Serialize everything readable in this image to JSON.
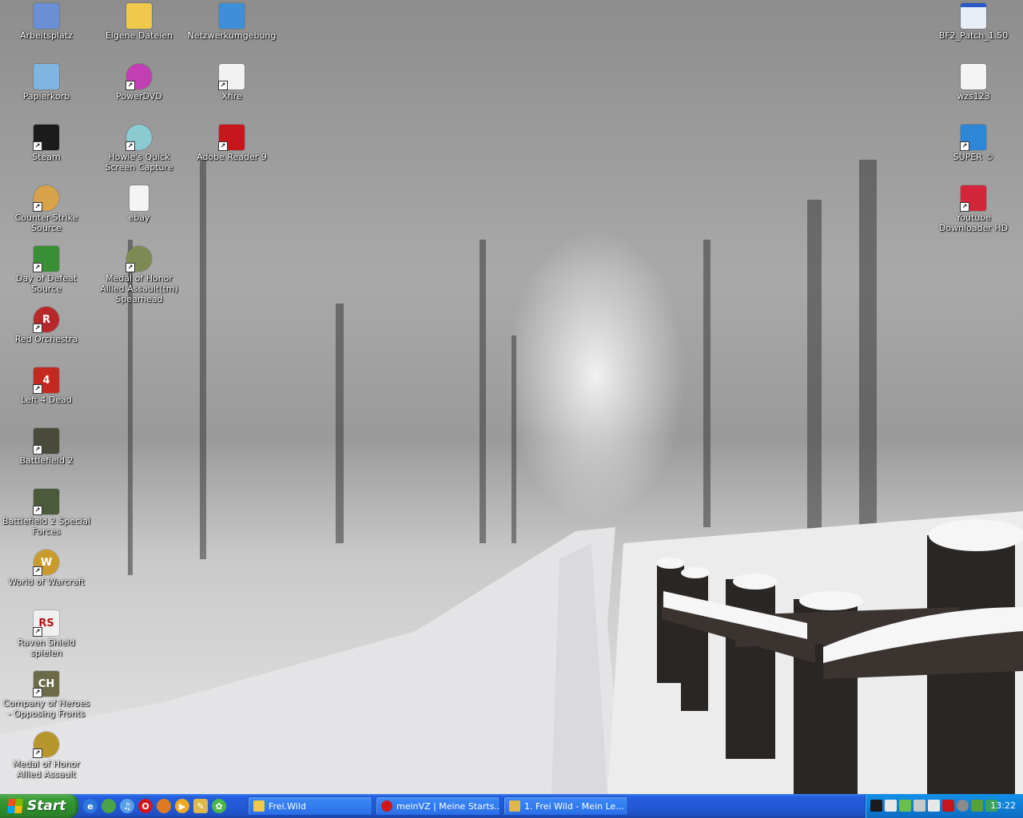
{
  "desktop": {
    "icons": [
      {
        "label": "Arbeitsplatz",
        "icon": "my-computer-icon",
        "color": "#6a8fd6",
        "glyph": "",
        "shortcut": false
      },
      {
        "label": "Eigene Dateien",
        "icon": "my-documents-folder-icon",
        "color": "#f0c94a",
        "glyph": "",
        "shortcut": false
      },
      {
        "label": "Netzwerkumgebung",
        "icon": "network-places-icon",
        "color": "#3f8fd8",
        "glyph": "",
        "shortcut": false
      },
      {
        "label": "Papierkorb",
        "icon": "recycle-bin-icon",
        "color": "#7fb5e0",
        "glyph": "",
        "shortcut": false
      },
      {
        "label": "PowerDVD",
        "icon": "powerdvd-disc-icon",
        "color": "#c13fb3",
        "glyph": "",
        "shortcut": true
      },
      {
        "label": "Xfire",
        "icon": "xfire-icon",
        "color": "#f2f2f2",
        "glyph": "",
        "shortcut": true
      },
      {
        "label": "Steam",
        "icon": "steam-icon",
        "color": "#1b1b1b",
        "glyph": "",
        "shortcut": true
      },
      {
        "label": "Howie's Quick Screen Capture",
        "icon": "camera-capture-icon",
        "color": "#8bcad1",
        "glyph": "",
        "shortcut": true
      },
      {
        "label": "Adobe Reader 9",
        "icon": "adobe-reader-icon",
        "color": "#c8161d",
        "glyph": "",
        "shortcut": true
      },
      {
        "label": "Counter-Strike Source",
        "icon": "counter-strike-icon",
        "color": "#d8a24a",
        "glyph": "",
        "shortcut": true
      },
      {
        "label": "ebay",
        "icon": "text-document-icon",
        "color": "#f4f4f4",
        "glyph": "",
        "shortcut": false
      },
      {
        "label": "Day of Defeat Source",
        "icon": "day-of-defeat-icon",
        "color": "#3a8f36",
        "glyph": "",
        "shortcut": true
      },
      {
        "label": "Medal of Honor Allied Assault(tm) Spearhead",
        "icon": "medal-of-honor-spearhead-icon",
        "color": "#7d8a54",
        "glyph": "",
        "shortcut": true
      },
      {
        "label": "Red Orchestra",
        "icon": "red-orchestra-icon",
        "color": "#b8282a",
        "glyph": "R",
        "shortcut": true
      },
      {
        "label": "Left 4 Dead",
        "icon": "left-4-dead-icon",
        "color": "#c42820",
        "glyph": "4",
        "shortcut": true
      },
      {
        "label": "Battlefield 2",
        "icon": "battlefield-2-icon",
        "color": "#4a4a3a",
        "glyph": "",
        "shortcut": true
      },
      {
        "label": "Battlefield 2 Special Forces",
        "icon": "battlefield-2-sf-icon",
        "color": "#4a5a3a",
        "glyph": "",
        "shortcut": true
      },
      {
        "label": "World of Warcraft",
        "icon": "world-of-warcraft-icon",
        "color": "#c99a2e",
        "glyph": "W",
        "shortcut": true
      },
      {
        "label": "Raven Shield spielen",
        "icon": "raven-shield-icon",
        "color": "#f0f0f0",
        "glyph": "RS",
        "shortcut": true
      },
      {
        "label": "Company of Heroes - Opposing Fronts",
        "icon": "company-of-heroes-icon",
        "color": "#6b6b4a",
        "glyph": "CH",
        "shortcut": true
      },
      {
        "label": "Medal of Honor Allied Assault",
        "icon": "medal-of-honor-icon",
        "color": "#b8962e",
        "glyph": "",
        "shortcut": true
      },
      {
        "label": "BF2_Patch_1.50",
        "icon": "application-window-icon",
        "color": "#e8eef8",
        "glyph": "",
        "shortcut": false
      },
      {
        "label": "wzs123",
        "icon": "wzs-file-icon",
        "color": "#f4f4f4",
        "glyph": "",
        "shortcut": false
      },
      {
        "label": "SUPER ©",
        "icon": "super-media-icon",
        "color": "#2f86d6",
        "glyph": "",
        "shortcut": true
      },
      {
        "label": "Youtube Downloader HD",
        "icon": "youtube-downloader-icon",
        "color": "#d4263a",
        "glyph": "",
        "shortcut": true
      }
    ]
  },
  "taskbar": {
    "start_label": "Start",
    "quick_launch": [
      {
        "icon": "internet-explorer-icon",
        "color": "#2d78d8"
      },
      {
        "icon": "messenger-icon",
        "color": "#4aa548"
      },
      {
        "icon": "itunes-icon",
        "color": "#5aa0e8"
      },
      {
        "icon": "opera-icon",
        "color": "#d0161b"
      },
      {
        "icon": "firefox-icon",
        "color": "#e07a1e"
      },
      {
        "icon": "media-player-icon",
        "color": "#f0a81e"
      },
      {
        "icon": "pencil-icon",
        "color": "#e0b84a"
      },
      {
        "icon": "icq-flower-icon",
        "color": "#4ab84a"
      }
    ],
    "tasks": [
      {
        "label": "Frei.Wild",
        "icon": "folder-icon",
        "color": "#f0c94a"
      },
      {
        "label": "meinVZ | Meine Starts...",
        "icon": "opera-icon",
        "color": "#d0161b"
      },
      {
        "label": "1. Frei Wild - Mein Le...",
        "icon": "pencil-icon",
        "color": "#e0b84a"
      }
    ],
    "tray_icons": [
      {
        "icon": "steam-tray-icon",
        "color": "#1b1b1b"
      },
      {
        "icon": "xfire-tray-icon",
        "color": "#e8e8e8"
      },
      {
        "icon": "network-tray-icon",
        "color": "#6bbf4a"
      },
      {
        "icon": "tool-tray-icon",
        "color": "#c8c8c8"
      },
      {
        "icon": "sound-tray-icon",
        "color": "#e8e8e8"
      },
      {
        "icon": "adobe-tray-icon",
        "color": "#c8161d"
      },
      {
        "icon": "power-tray-icon",
        "color": "#8a8a8a"
      },
      {
        "icon": "hardware-tray-icon",
        "color": "#5aa03a"
      },
      {
        "icon": "security-tray-icon",
        "color": "#3aa05a"
      }
    ],
    "clock": "13:22"
  }
}
